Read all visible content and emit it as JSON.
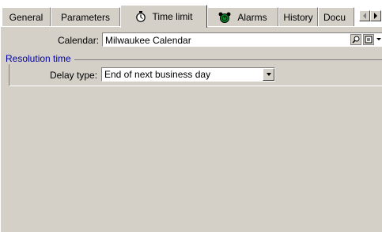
{
  "tabs": [
    {
      "label": "General"
    },
    {
      "label": "Parameters"
    },
    {
      "label": "Time limit",
      "icon": "stopwatch-icon"
    },
    {
      "label": "Alarms",
      "icon": "alarm-clock-icon"
    },
    {
      "label": "History"
    },
    {
      "label": "Docu"
    }
  ],
  "calendar": {
    "label": "Calendar:",
    "value": "Milwaukee Calendar"
  },
  "resolution": {
    "group_title": "Resolution time",
    "delay_label": "Delay type:",
    "delay_value": "End of next business day"
  },
  "colors": {
    "panel": "#d4d0c8",
    "group_title": "#0000a0",
    "alarm_icon": "#0a8a2a"
  }
}
